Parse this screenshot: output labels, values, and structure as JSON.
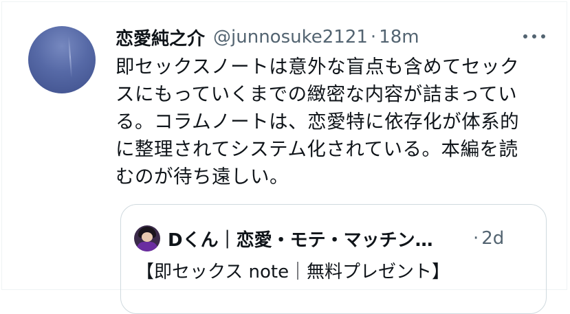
{
  "tweet": {
    "author_name": "恋愛純之介",
    "handle": "@junnosuke2121",
    "separator": "·",
    "time": "18m",
    "lines": [
      "即セックスノートは意外な盲点も含めてセック",
      "スにもっていくまでの緻密な内容が詰まってい",
      "る。コラムノートは、恋愛特に依存化が体系的",
      "に整理されてシステム化されている。本編を読",
      "むのが待ち遠しい。"
    ]
  },
  "quoted_tweet": {
    "author_name": "Dくん｜恋愛・モテ・マッチン…",
    "separator": "·",
    "time": "2d",
    "text": "【即セックス note｜無料プレゼント】"
  },
  "icons": {
    "more": "more-options-icon",
    "avatar": "user-avatar",
    "quoted_avatar": "quoted-user-avatar"
  },
  "colors": {
    "primary_text": "#0f1419",
    "secondary_text": "#536471",
    "border": "#cfd9de"
  }
}
